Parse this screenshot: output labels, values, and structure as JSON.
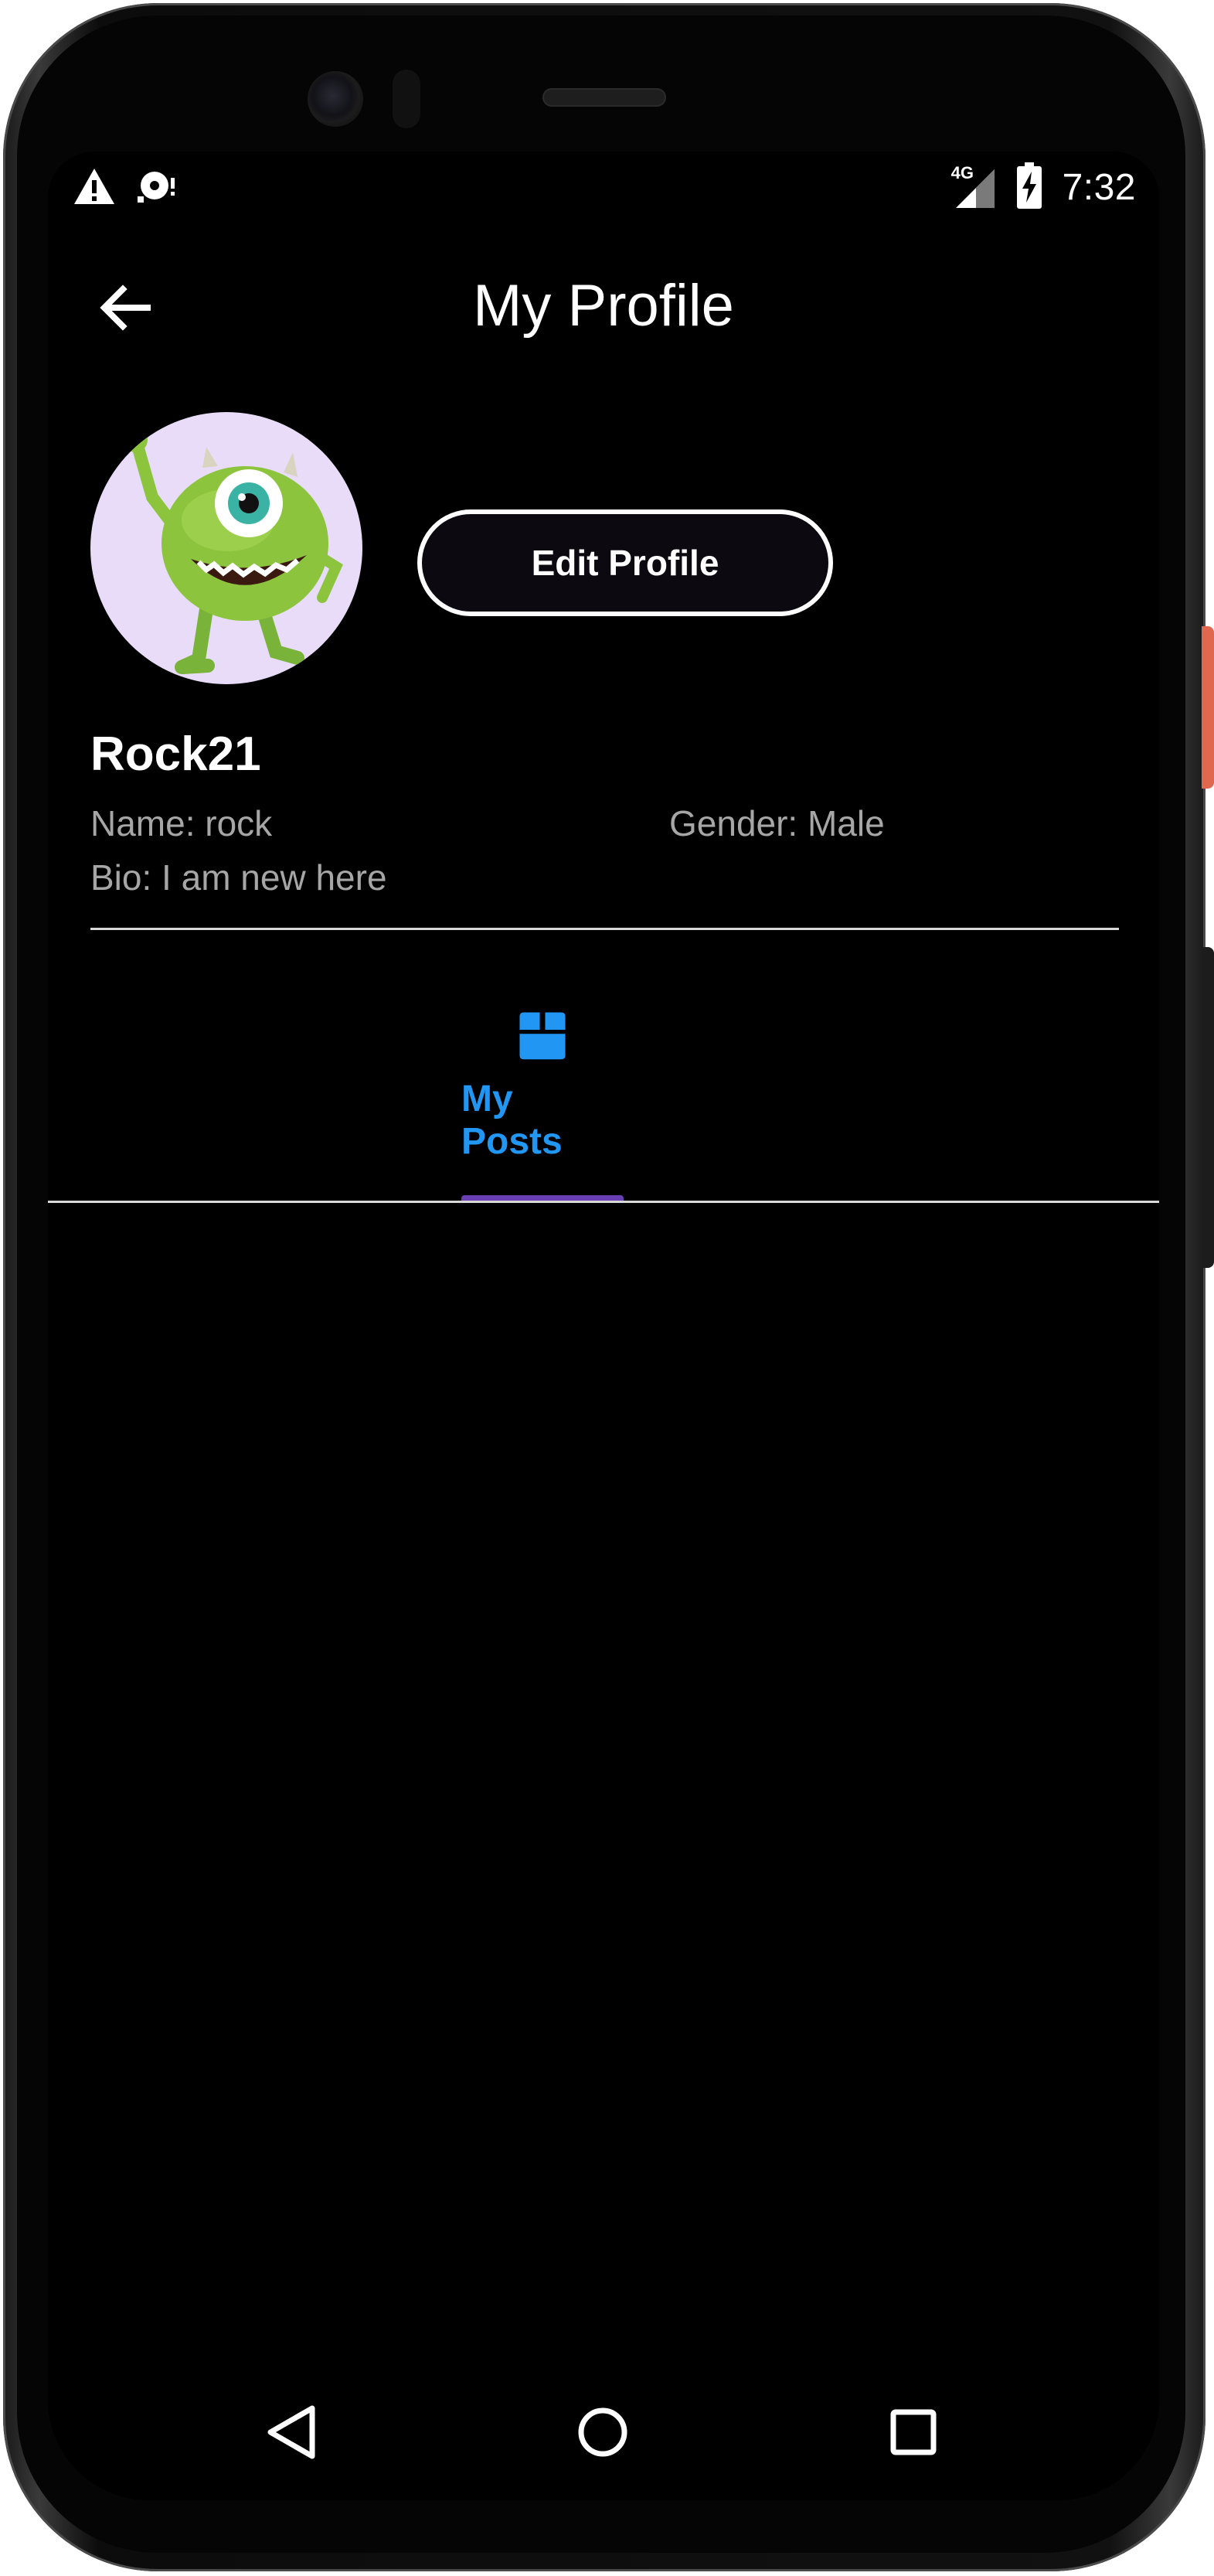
{
  "status_bar": {
    "time": "7:32",
    "network": "4G",
    "icons": [
      "warning-icon",
      "sd-card-icon",
      "signal-icon",
      "battery-charging-icon"
    ]
  },
  "header": {
    "title": "My Profile",
    "back_icon": "arrow-left-icon"
  },
  "profile": {
    "username": "Rock21",
    "name": "Name: rock",
    "gender": "Gender: Male",
    "bio": "Bio: I am new here",
    "edit_label": "Edit Profile",
    "avatar_icon": "green-one-eyed-monster-avatar"
  },
  "tabs": [
    {
      "label": "My Posts",
      "icon": "package-box-icon",
      "active": true
    }
  ],
  "colors": {
    "background": "#000000",
    "accent": "#2196f3",
    "tab_indicator": "#6a3fb4",
    "secondary_text": "#a6a6a6",
    "avatar_bg": "#e8dcf8"
  },
  "nav_bar": {
    "buttons": [
      "nav-back-icon",
      "nav-home-icon",
      "nav-recent-icon"
    ]
  }
}
